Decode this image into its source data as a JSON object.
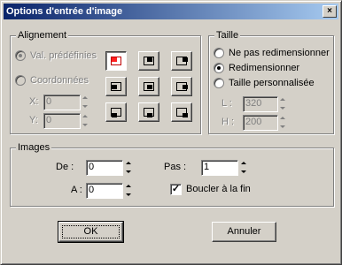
{
  "window": {
    "title": "Options d'entrée d'image",
    "close_glyph": "×"
  },
  "alignment": {
    "label": "Alignement",
    "radio_presets": "Val. prédéfinies",
    "radio_coords": "Coordonnées",
    "x_label": "X:",
    "y_label": "Y:",
    "x_value": "0",
    "y_value": "0",
    "grid": [
      {
        "name": "align-top-left-icon",
        "active": true
      },
      {
        "name": "align-top-center-icon",
        "active": false
      },
      {
        "name": "align-top-right-icon",
        "active": false
      },
      {
        "name": "align-middle-left-icon",
        "active": false
      },
      {
        "name": "align-center-icon",
        "active": false
      },
      {
        "name": "align-middle-right-icon",
        "active": false
      },
      {
        "name": "align-bottom-left-icon",
        "active": false
      },
      {
        "name": "align-bottom-center-icon",
        "active": false
      },
      {
        "name": "align-bottom-right-icon",
        "active": false
      }
    ]
  },
  "size": {
    "label": "Taille",
    "opt_no_resize": "Ne pas redimensionner",
    "opt_resize": "Redimensionner",
    "opt_custom": "Taille personnalisée",
    "selected": "Redimensionner",
    "w_label": "L :",
    "h_label": "H :",
    "w_value": "320",
    "h_value": "200"
  },
  "images": {
    "label": "Images",
    "from_label": "De :",
    "from_value": "0",
    "to_label": "A :",
    "to_value": "0",
    "step_label": "Pas :",
    "step_value": "1",
    "loop_label": "Boucler à la fin",
    "loop_checked": true
  },
  "buttons": {
    "ok": "OK",
    "cancel": "Annuler"
  }
}
